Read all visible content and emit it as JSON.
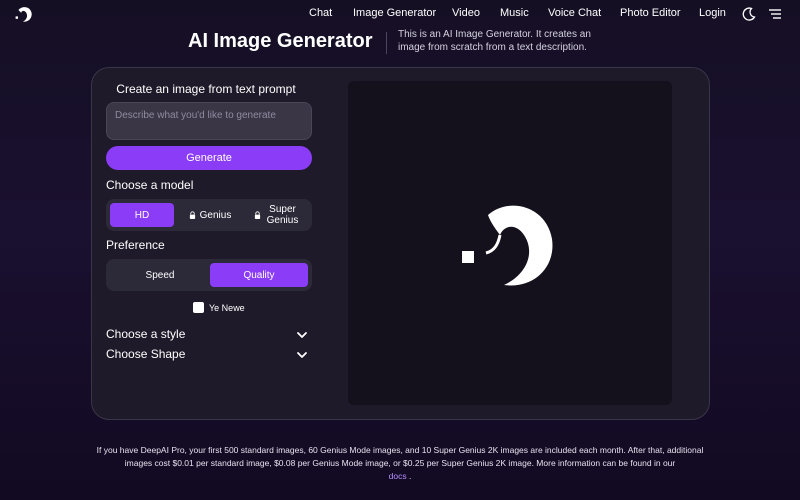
{
  "nav": {
    "items": [
      "Chat",
      "Image Generator",
      "Video",
      "Music",
      "Voice Chat",
      "Photo Editor",
      "Login"
    ],
    "icons": [
      "theme-toggle-icon",
      "menu-icon"
    ]
  },
  "header": {
    "title": "AI Image Generator",
    "description": "This is an AI Image Generator. It creates an image from scratch from a text description."
  },
  "form": {
    "prompt_heading": "Create an image from text prompt",
    "prompt_placeholder": "Describe what you'd like to generate",
    "prompt_value": "",
    "generate_label": "Generate",
    "model_label": "Choose a model",
    "models": [
      {
        "label": "HD",
        "selected": true,
        "locked": false
      },
      {
        "label": "Genius",
        "selected": false,
        "locked": true
      },
      {
        "label": "Super Genius",
        "selected": false,
        "locked": true
      }
    ],
    "preference_label": "Preference",
    "preferences": [
      {
        "label": "Speed",
        "selected": false
      },
      {
        "label": "Quality",
        "selected": true
      }
    ],
    "checkbox_label": "Ye Newe",
    "checkbox_checked": false,
    "style_label": "Choose a style",
    "shape_label": "Choose Shape"
  },
  "footer": {
    "text": "If you have DeepAI Pro, your first 500 standard images, 60 Genius Mode images, and 10 Super Genius 2K images are included each month. After that, additional images cost $0.01 per standard image, $0.08 per Genius Mode image, or $0.25 per Super Genius 2K image. More information can be found in our",
    "link_text": "docs",
    "suffix": "."
  },
  "colors": {
    "accent": "#8b3cf7",
    "panel": "#1e1a29",
    "background": "#150f24",
    "link": "#b690ff"
  }
}
